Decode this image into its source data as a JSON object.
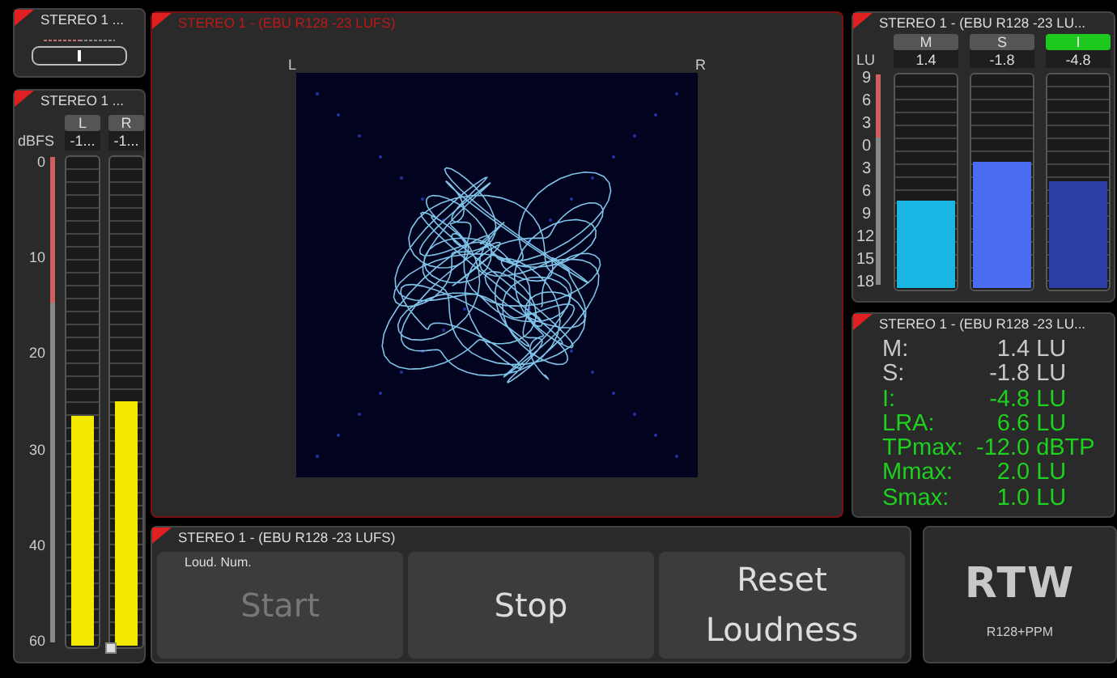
{
  "balance_panel": {
    "title": "STEREO 1 ..."
  },
  "ppm_panel": {
    "title": "STEREO 1 ...",
    "unit": "dBFS",
    "scale": [
      "0",
      "10",
      "20",
      "30",
      "40",
      "60"
    ],
    "channels": [
      {
        "label": "L",
        "reading": "-1...",
        "level": 0.47
      },
      {
        "label": "R",
        "reading": "-1...",
        "level": 0.5
      }
    ]
  },
  "vectorscope": {
    "title": "STEREO 1 - (EBU R128 -23 LUFS)",
    "left_label": "L",
    "right_label": "R"
  },
  "loudness_bars": {
    "title": "STEREO 1 - (EBU R128 -23 LU...",
    "unit": "LU",
    "scale": [
      "9",
      "6",
      "3",
      "0",
      "3",
      "6",
      "9",
      "12",
      "15",
      "18"
    ],
    "bars": [
      {
        "label": "M",
        "active": false,
        "reading": "1.4",
        "level": 0.41,
        "color": "#1ab6e4"
      },
      {
        "label": "S",
        "active": false,
        "reading": "-1.8",
        "level": 0.59,
        "color": "#4a6cee"
      },
      {
        "label": "I",
        "active": true,
        "reading": "-4.8",
        "level": 0.5,
        "color": "#2c3ea6"
      }
    ]
  },
  "loudness_values": {
    "title": "STEREO 1 - (EBU R128 -23 LU...",
    "rows": [
      {
        "label": "M:",
        "value": "1.4",
        "unit": "LU",
        "color": "#c8c8c8"
      },
      {
        "label": "S:",
        "value": "-1.8",
        "unit": "LU",
        "color": "#c8c8c8"
      },
      {
        "label": "I:",
        "value": "-4.8",
        "unit": "LU",
        "color": "#1fd01f"
      },
      {
        "label": "LRA:",
        "value": "6.6",
        "unit": "LU",
        "color": "#1fd01f"
      },
      {
        "label": "TPmax:",
        "value": "-12.0",
        "unit": "dBTP",
        "color": "#1fd01f"
      },
      {
        "label": "Mmax:",
        "value": "2.0",
        "unit": "LU",
        "color": "#1fd01f"
      },
      {
        "label": "Smax:",
        "value": "1.0",
        "unit": "LU",
        "color": "#1fd01f"
      }
    ]
  },
  "controls": {
    "title": "STEREO 1 - (EBU R128 -23 LUFS)",
    "section_label": "Loud. Num.",
    "buttons": [
      {
        "label": "Start",
        "disabled": true
      },
      {
        "label": "Stop",
        "disabled": false
      },
      {
        "label": "Reset Loudness",
        "disabled": false
      }
    ]
  },
  "logo_panel": {
    "logo": "RTW",
    "caption": "R128+PPM"
  }
}
